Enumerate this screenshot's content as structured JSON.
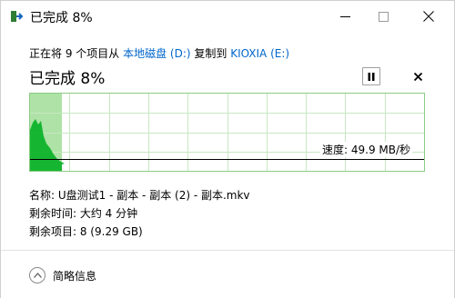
{
  "window": {
    "title": "已完成 8%",
    "colors": {
      "accent_link": "#0066cc",
      "graph_fill": "#06b025",
      "graph_done": "#aee2a6",
      "grid": "#c8e8c2"
    }
  },
  "status": {
    "prefix": "正在将 9 个项目从 ",
    "source": "本地磁盘 (D:)",
    "middle": " 复制到 ",
    "destination": "KIOXIA (E:)"
  },
  "progress": {
    "title": "已完成 8%",
    "percent": 8
  },
  "controls": {
    "pause_icon": "pause-icon",
    "cancel_icon": "close-icon"
  },
  "graph": {
    "speed_text": "速度: 49.9 MB/秒"
  },
  "details": {
    "name_row": "名称: U盘测试1 - 副本 - 副本 (2) - 副本.mkv",
    "time_row": "剩余时间: 大约 4 分钟",
    "items_row": "剩余项目: 8 (9.29 GB)"
  },
  "footer": {
    "toggle_label": "简略信息",
    "toggle_icon": "chevron-up-icon"
  }
}
